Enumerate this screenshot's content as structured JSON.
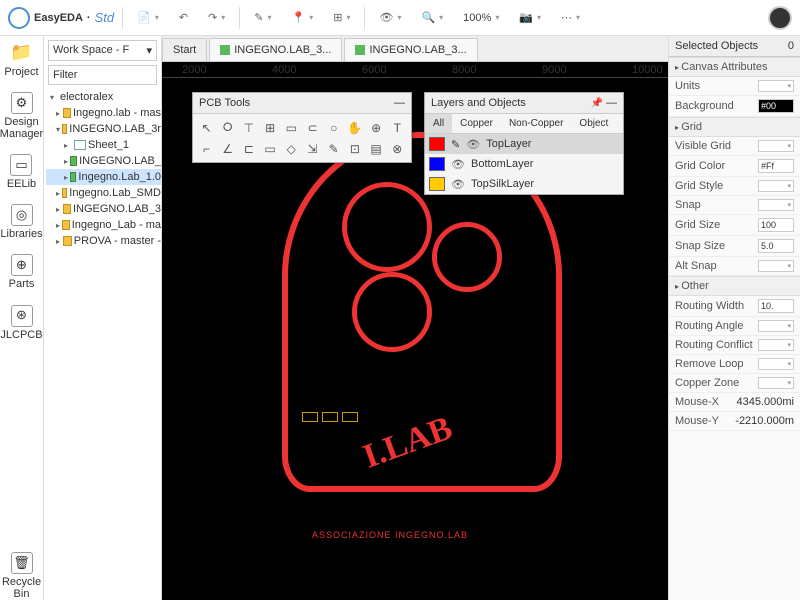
{
  "app": {
    "name": "EasyEDA",
    "edition": "Std"
  },
  "toolbar": {
    "zoom": "100%"
  },
  "leftbar": [
    {
      "icon": "📁",
      "label": "Project"
    },
    {
      "icon": "⚙",
      "label": "Design Manager"
    },
    {
      "icon": "▭",
      "label": "EELib"
    },
    {
      "icon": "◎",
      "label": "Libraries"
    },
    {
      "icon": "⊕",
      "label": "Parts"
    },
    {
      "icon": "⊛",
      "label": "JLCPCB"
    }
  ],
  "recycle": {
    "label": "Recycle Bin"
  },
  "workspace": {
    "select": "Work Space - F",
    "filter_placeholder": "Filter"
  },
  "tree": {
    "root": "electoralex",
    "items": [
      {
        "l": 1,
        "t": "folder",
        "label": "Ingegno.lab - mas"
      },
      {
        "l": 1,
        "t": "folder",
        "label": "INGEGNO.LAB_3r",
        "open": true
      },
      {
        "l": 2,
        "t": "sheet",
        "label": "Sheet_1"
      },
      {
        "l": 2,
        "t": "pcb",
        "label": "INGEGNO.LAB_"
      },
      {
        "l": 2,
        "t": "pcb",
        "label": "Ingegno.Lab_1.0",
        "sel": true
      },
      {
        "l": 1,
        "t": "folder",
        "label": "Ingegno.Lab_SMD"
      },
      {
        "l": 1,
        "t": "folder",
        "label": "INGEGNO.LAB_3"
      },
      {
        "l": 1,
        "t": "folder",
        "label": "Ingegno_Lab - ma"
      },
      {
        "l": 1,
        "t": "folder",
        "label": "PROVA - master -"
      }
    ]
  },
  "tabs": [
    {
      "label": "Start",
      "start": true
    },
    {
      "label": "INGEGNO.LAB_3...",
      "ico": "pcb"
    },
    {
      "label": "INGEGNO.LAB_3...",
      "ico": "pcb"
    }
  ],
  "ruler": [
    "2000",
    "4000",
    "6000",
    "8000",
    "9000",
    "10000"
  ],
  "design": {
    "text": "I.LAB",
    "assoc": "ASSOCIAZIONE INGEGNO.LAB"
  },
  "pcb_tools": {
    "title": "PCB Tools",
    "tools": [
      "↖",
      "⭘",
      "⊤",
      "⊞",
      "▭",
      "⊂",
      "○",
      "✋",
      "⊕",
      "T",
      "⌐",
      "∠",
      "⊏",
      "▭",
      "◇",
      "⇲",
      "✎",
      "⊡",
      "▤",
      "⊗"
    ]
  },
  "layers": {
    "title": "Layers and Objects",
    "tabs": [
      "All",
      "Copper",
      "Non-Copper",
      "Object"
    ],
    "rows": [
      {
        "c": "#f00",
        "name": "TopLayer",
        "sel": true,
        "pen": true
      },
      {
        "c": "#00f",
        "name": "BottomLayer"
      },
      {
        "c": "#fc0",
        "name": "TopSilkLayer"
      }
    ]
  },
  "right": {
    "selected": {
      "label": "Selected Objects",
      "count": "0"
    },
    "sections": [
      {
        "title": "Canvas Attributes",
        "rows": [
          {
            "k": "Units",
            "v": "",
            "dd": true
          },
          {
            "k": "Background",
            "v": "#00",
            "color": true
          }
        ]
      },
      {
        "title": "Grid",
        "rows": [
          {
            "k": "Visible Grid",
            "v": "",
            "dd": true
          },
          {
            "k": "Grid Color",
            "v": "#Ff"
          },
          {
            "k": "Grid Style",
            "v": "",
            "dd": true
          },
          {
            "k": "Snap",
            "v": "",
            "dd": true
          },
          {
            "k": "Grid Size",
            "v": "100"
          },
          {
            "k": "Snap Size",
            "v": "5.0"
          },
          {
            "k": "Alt Snap",
            "v": "",
            "dd": true
          }
        ]
      },
      {
        "title": "Other",
        "rows": [
          {
            "k": "Routing Width",
            "v": "10."
          },
          {
            "k": "Routing Angle",
            "v": "",
            "dd": true
          },
          {
            "k": "Routing Conflict",
            "v": "",
            "dd": true
          },
          {
            "k": "Remove Loop",
            "v": "",
            "dd": true
          },
          {
            "k": "Copper Zone",
            "v": "",
            "dd": true
          }
        ]
      }
    ],
    "mouse": {
      "x_label": "Mouse-X",
      "x": "4345.000mi",
      "y_label": "Mouse-Y",
      "y": "-2210.000m"
    }
  }
}
